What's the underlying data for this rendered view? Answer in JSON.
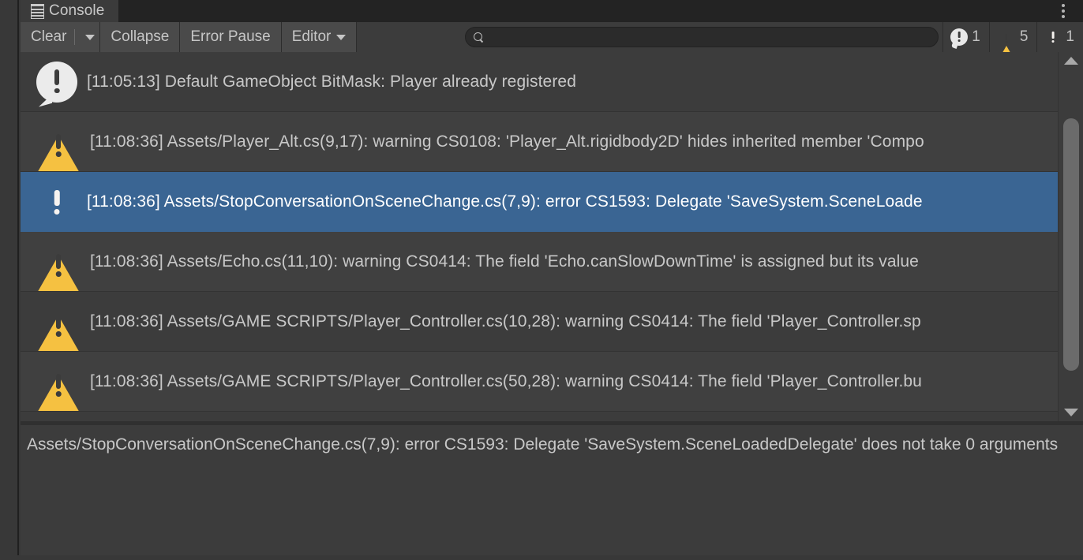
{
  "window": {
    "tab_label": "Console",
    "tab_icon": "console-doc-icon",
    "menu_icon": "kebab-menu-icon"
  },
  "toolbar": {
    "clear_label": "Clear",
    "clear_dropdown_icon": "chevron-down-icon",
    "collapse_label": "Collapse",
    "error_pause_label": "Error Pause",
    "editor_label": "Editor",
    "editor_dropdown_icon": "chevron-down-icon",
    "search": {
      "icon": "search-icon",
      "value": "",
      "placeholder": ""
    },
    "counters": [
      {
        "type": "info",
        "icon": "info-bubble-icon",
        "count": "1"
      },
      {
        "type": "warning",
        "icon": "warning-triangle-icon",
        "count": "5"
      },
      {
        "type": "error",
        "icon": "error-octagon-icon",
        "count": "1"
      }
    ]
  },
  "log": {
    "rows": [
      {
        "severity": "info",
        "icon": "info-bubble-icon",
        "text": "[11:05:13] Default GameObject BitMask: Player already registered",
        "selected": false
      },
      {
        "severity": "warning",
        "icon": "warning-triangle-icon",
        "text": "[11:08:36] Assets/Player_Alt.cs(9,17): warning CS0108: 'Player_Alt.rigidbody2D' hides inherited member 'Compo",
        "selected": false
      },
      {
        "severity": "error",
        "icon": "error-octagon-icon",
        "text": "[11:08:36] Assets/StopConversationOnSceneChange.cs(7,9): error CS1593: Delegate 'SaveSystem.SceneLoade",
        "selected": true
      },
      {
        "severity": "warning",
        "icon": "warning-triangle-icon",
        "text": "[11:08:36] Assets/Echo.cs(11,10): warning CS0414: The field 'Echo.canSlowDownTime' is assigned but its value",
        "selected": false
      },
      {
        "severity": "warning",
        "icon": "warning-triangle-icon",
        "text": "[11:08:36] Assets/GAME SCRIPTS/Player_Controller.cs(10,28): warning CS0414: The field 'Player_Controller.sp",
        "selected": false
      },
      {
        "severity": "warning",
        "icon": "warning-triangle-icon",
        "text": "[11:08:36] Assets/GAME SCRIPTS/Player_Controller.cs(50,28): warning CS0414: The field 'Player_Controller.bu",
        "selected": false
      }
    ]
  },
  "scrollbar": {
    "up_icon": "scroll-up-arrow-icon",
    "down_icon": "scroll-down-arrow-icon"
  },
  "detail": {
    "text": "Assets/StopConversationOnSceneChange.cs(7,9): error CS1593: Delegate 'SaveSystem.SceneLoadedDelegate' does not take 0 arguments"
  },
  "colors": {
    "panel_bg": "#3c3c3c",
    "row_alt_bg": "#404040",
    "selection_blue": "#3a6593",
    "warning_yellow": "#f5c141",
    "error_orange": "#e8643c",
    "info_white": "#ebebeb",
    "text": "#c8c8c8"
  }
}
